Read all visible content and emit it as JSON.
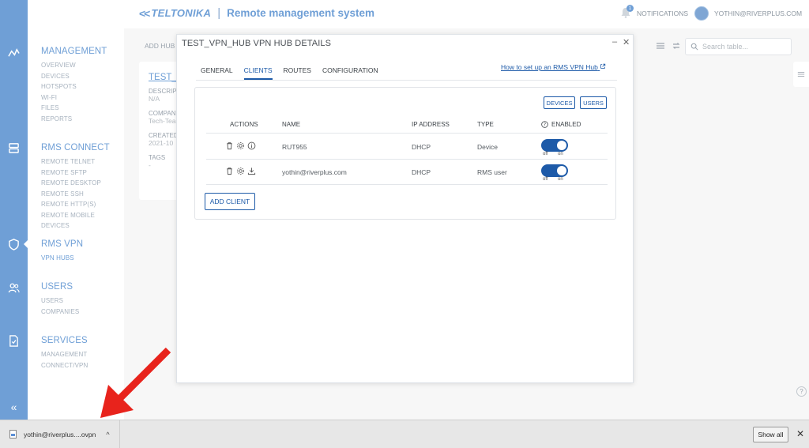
{
  "header": {
    "brand": "TELTONIKA",
    "separator": "|",
    "title": "Remote management system",
    "notifications_label": "NOTIFICATIONS",
    "notifications_count": "1",
    "user_email": "YOTHIN@RIVERPLUS.COM"
  },
  "sidebar": {
    "sections": [
      {
        "title": "MANAGEMENT",
        "items": [
          "OVERVIEW",
          "DEVICES",
          "HOTSPOTS",
          "WI-FI",
          "FILES",
          "REPORTS"
        ]
      },
      {
        "title": "RMS CONNECT",
        "items": [
          "REMOTE TELNET",
          "REMOTE SFTP",
          "REMOTE DESKTOP",
          "REMOTE SSH",
          "REMOTE HTTP(S)",
          "REMOTE MOBILE DEVICES"
        ]
      },
      {
        "title": "RMS VPN",
        "items": [
          "VPN HUBS"
        ]
      },
      {
        "title": "USERS",
        "items": [
          "USERS",
          "COMPANIES"
        ]
      },
      {
        "title": "SERVICES",
        "items": [
          "MANAGEMENT",
          "CONNECT/VPN"
        ]
      }
    ],
    "collapse_label": "«"
  },
  "background": {
    "add_hub": "ADD HUB",
    "hub_name": "TEST_VI",
    "description_label": "DESCRIP",
    "description_value": "N/A",
    "company_label": "COMPANY",
    "company_value": "Tech-Tea",
    "created_label": "CREATED",
    "created_value": "2021-10",
    "tags_label": "TAGS",
    "tags_value": "-",
    "search_placeholder": "Search table...",
    "help": "?"
  },
  "modal": {
    "title": "TEST_VPN_HUB VPN HUB DETAILS",
    "minimize": "–",
    "close": "✕",
    "tabs": [
      "GENERAL",
      "CLIENTS",
      "ROUTES",
      "CONFIGURATION"
    ],
    "active_tab": "CLIENTS",
    "howto_link": "How to set up an RMS VPN Hub",
    "devices_button": "DEVICES",
    "users_button": "USERS",
    "columns": {
      "actions": "ACTIONS",
      "name": "NAME",
      "ip": "IP ADDRESS",
      "type": "TYPE",
      "enabled": "ENABLED"
    },
    "rows": [
      {
        "name": "RUT955",
        "ip": "DHCP",
        "type": "Device",
        "enabled": true,
        "toggle_off": "off",
        "toggle_on": "on"
      },
      {
        "name": "yothin@riverplus.com",
        "ip": "DHCP",
        "type": "RMS user",
        "enabled": true,
        "toggle_off": "off",
        "toggle_on": "on"
      }
    ],
    "add_client": "ADD CLIENT"
  },
  "download_bar": {
    "file_name": "yothin@riverplus....ovpn",
    "chevron": "^",
    "show_all": "Show all",
    "close": "✕"
  },
  "colors": {
    "rail": "#6f9fd6",
    "accent": "#1d5aa8",
    "annotation_arrow": "#e8231c"
  }
}
